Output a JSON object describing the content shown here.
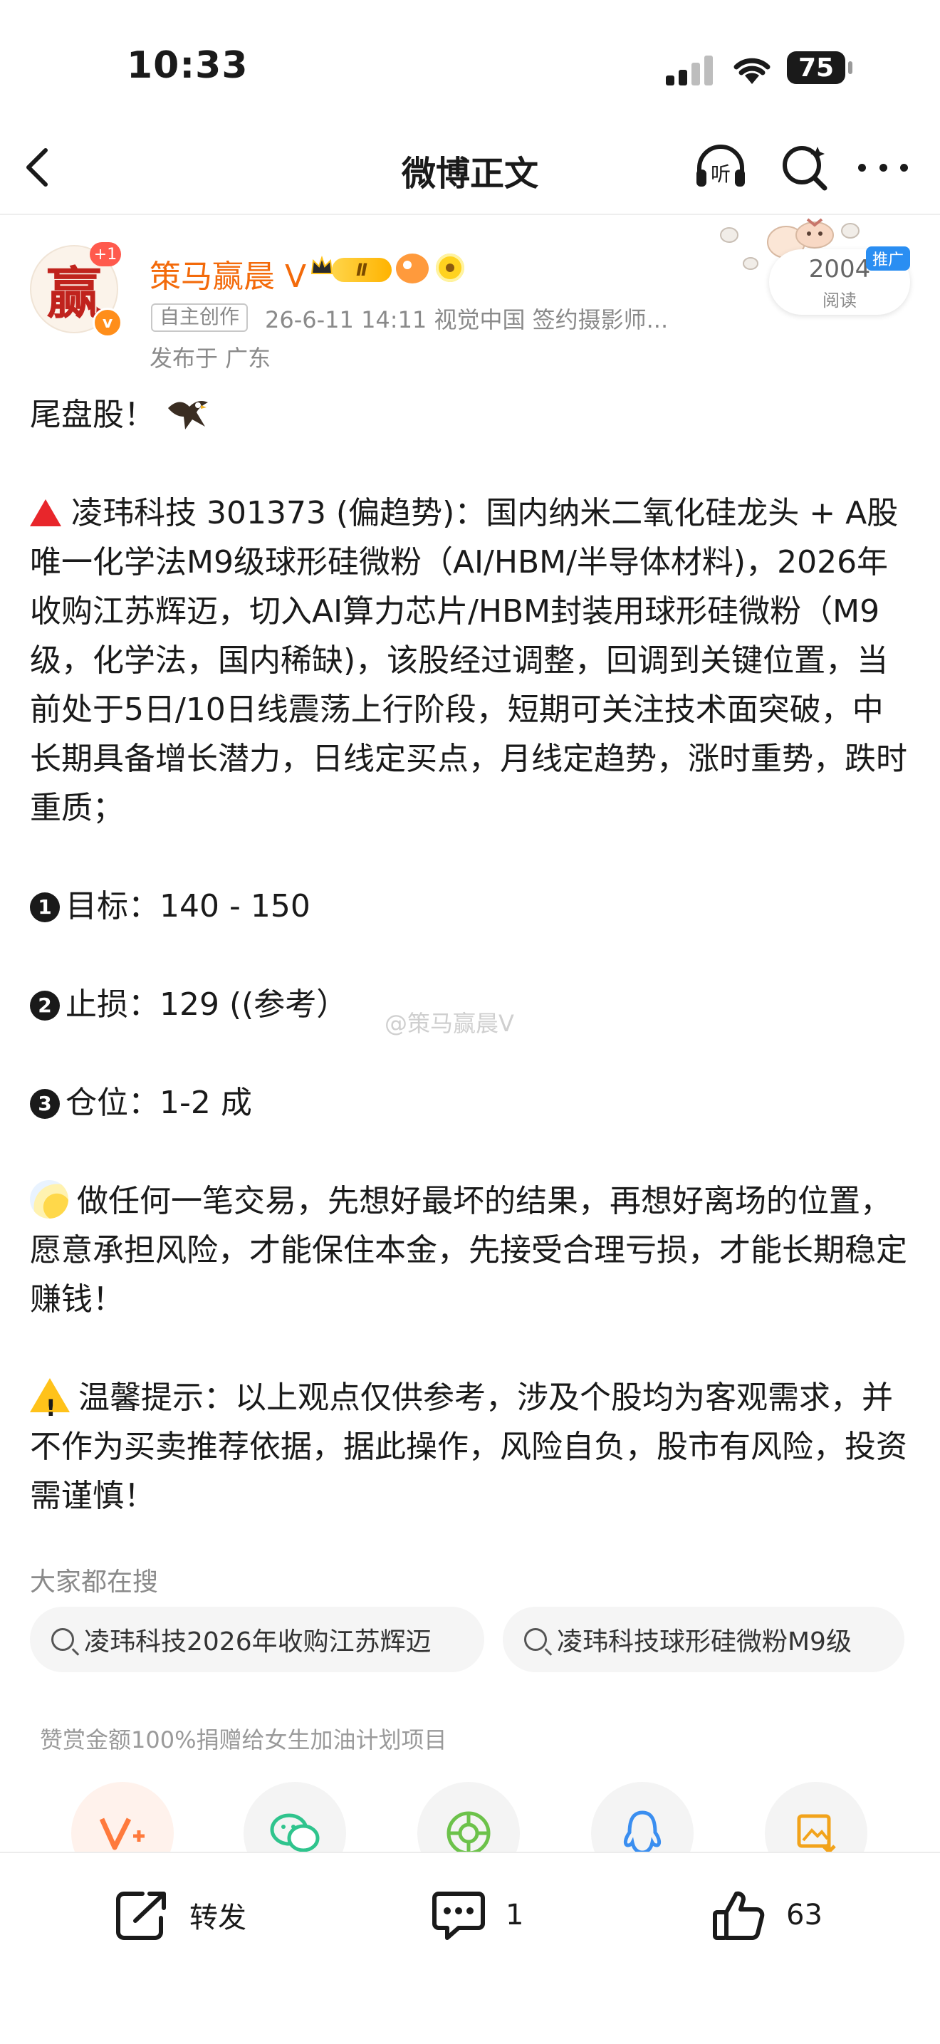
{
  "status_bar": {
    "time": "10:33",
    "battery": "75"
  },
  "nav": {
    "title": "微博正文"
  },
  "author": {
    "avatar_char": "赢",
    "follow_badge": "+1",
    "verified_mark": "v",
    "name": "策马赢晨 V",
    "level": "Ⅱ",
    "tag_original": "自主创作",
    "meta": "26-6-11 14:11  视觉中国 签约摄影师...",
    "location": "发布于 广东"
  },
  "reads": {
    "count": "2004",
    "label": "阅读",
    "promo": "推广"
  },
  "post": {
    "line1": "尾盘股！",
    "p1": "凌玮科技 301373 (偏趋势)：国内纳米二氧化硅龙头 + A股唯一化学法M9级球形硅微粉（AI/HBM/半导体材料)，2026年收购江苏辉迈，切入AI算力芯片/HBM封装用球形硅微粉（M9级，化学法，国内稀缺)，该股经过调整，回调到关键位置，当前处于5日/10日线震荡上行阶段，短期可关注技术面突破，中长期具备增长潜力，日线定买点，月线定趋势，涨时重势，跌时重质；",
    "n1": "1",
    "target": "目标：140 - 150",
    "n2": "2",
    "stop": "止损：129 ((参考）",
    "n3": "3",
    "position": "仓位：1-2 成",
    "p2": "做任何一笔交易，先想好最坏的结果，再想好离场的位置，愿意承担风险，才能保住本金，先接受合理亏损，才能长期稳定赚钱！",
    "p3": "温馨提示：以上观点仅供参考，涉及个股均为客观需求，并不作为买卖推荐依据，据此操作，风险自负，股市有风险，投资需谨慎！"
  },
  "watermark": "@策马赢晨V",
  "search": {
    "title": "大家都在搜",
    "chips": [
      "凌玮科技2026年收购江苏辉迈",
      "凌玮科技球形硅微粉M9级"
    ]
  },
  "donate_text": "赞赏金额100%捐赠给女生加油计划项目",
  "share_icons": [
    "weibo-v-plus-icon",
    "wechat-icon",
    "moments-icon",
    "qq-icon",
    "save-image-icon"
  ],
  "actions": {
    "repost": "转发",
    "comment": "1",
    "like": "63"
  },
  "colors": {
    "orange_name": "#f36a0a",
    "alert_red": "#e8262b",
    "promo_blue": "#2a8ef2"
  }
}
